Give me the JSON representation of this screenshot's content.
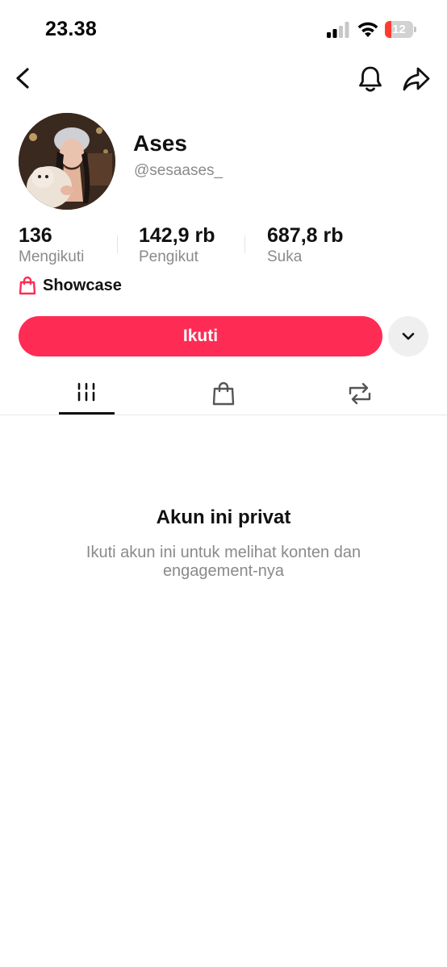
{
  "status_bar": {
    "time": "23.38",
    "battery_level": "12",
    "battery_fraction": 0.12,
    "battery_color": "#ff3b30"
  },
  "nav": {
    "back_icon": "chevron-left-icon",
    "notification_icon": "bell-icon",
    "share_icon": "share-arrow-icon"
  },
  "profile": {
    "display_name": "Ases",
    "username": "@sesaases_"
  },
  "stats": [
    {
      "value": "136",
      "label": "Mengikuti"
    },
    {
      "value": "142,9 rb",
      "label": "Pengikut"
    },
    {
      "value": "687,8 rb",
      "label": "Suka"
    }
  ],
  "showcase": {
    "label": "Showcase",
    "icon": "shopping-bag-icon"
  },
  "actions": {
    "follow_label": "Ikuti",
    "follow_color": "#fe2c55",
    "more_icon": "chevron-down-icon"
  },
  "tabs": [
    {
      "icon": "grid-icon",
      "active": true
    },
    {
      "icon": "shopping-bag-icon",
      "active": false
    },
    {
      "icon": "repost-icon",
      "active": false
    }
  ],
  "private_notice": {
    "title": "Akun ini privat",
    "description": "Ikuti akun ini untuk melihat konten dan engagement-nya"
  }
}
